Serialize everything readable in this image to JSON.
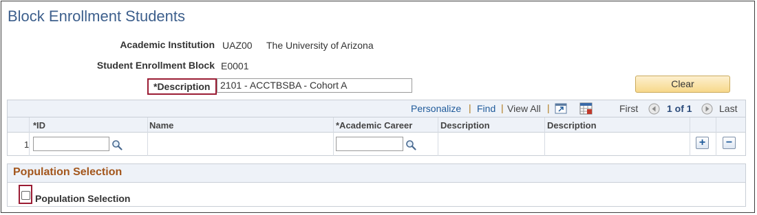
{
  "page": {
    "title": "Block Enrollment Students"
  },
  "fields": {
    "academic_institution": {
      "label": "Academic Institution",
      "code": "UAZ00",
      "name": "The University of Arizona"
    },
    "student_enrollment_block": {
      "label": "Student Enrollment Block",
      "value": "E0001"
    },
    "description": {
      "label": "*Description",
      "value": "2101 - ACCTBSBA - Cohort A"
    }
  },
  "buttons": {
    "clear": "Clear"
  },
  "grid": {
    "toolbar": {
      "personalize": "Personalize",
      "find": "Find",
      "view_all": "View All",
      "first": "First",
      "range": "1 of 1",
      "last": "Last",
      "separator": "|"
    },
    "columns": [
      "*ID",
      "Name",
      "*Academic Career",
      "Description",
      "Description"
    ],
    "rows": [
      {
        "num": "1",
        "id": "",
        "name": "",
        "academic_career": "",
        "description1": "",
        "description2": ""
      }
    ],
    "row_buttons": {
      "add": "+",
      "delete": "−"
    }
  },
  "population_selection": {
    "section_title": "Population Selection",
    "checkbox_label": "Population Selection",
    "checked": false
  },
  "colors": {
    "title": "#3d5f8c",
    "link": "#1e5a9a",
    "section_title": "#a3561c",
    "highlight": "#9a1b33",
    "clear_button": "#f7d88a"
  }
}
